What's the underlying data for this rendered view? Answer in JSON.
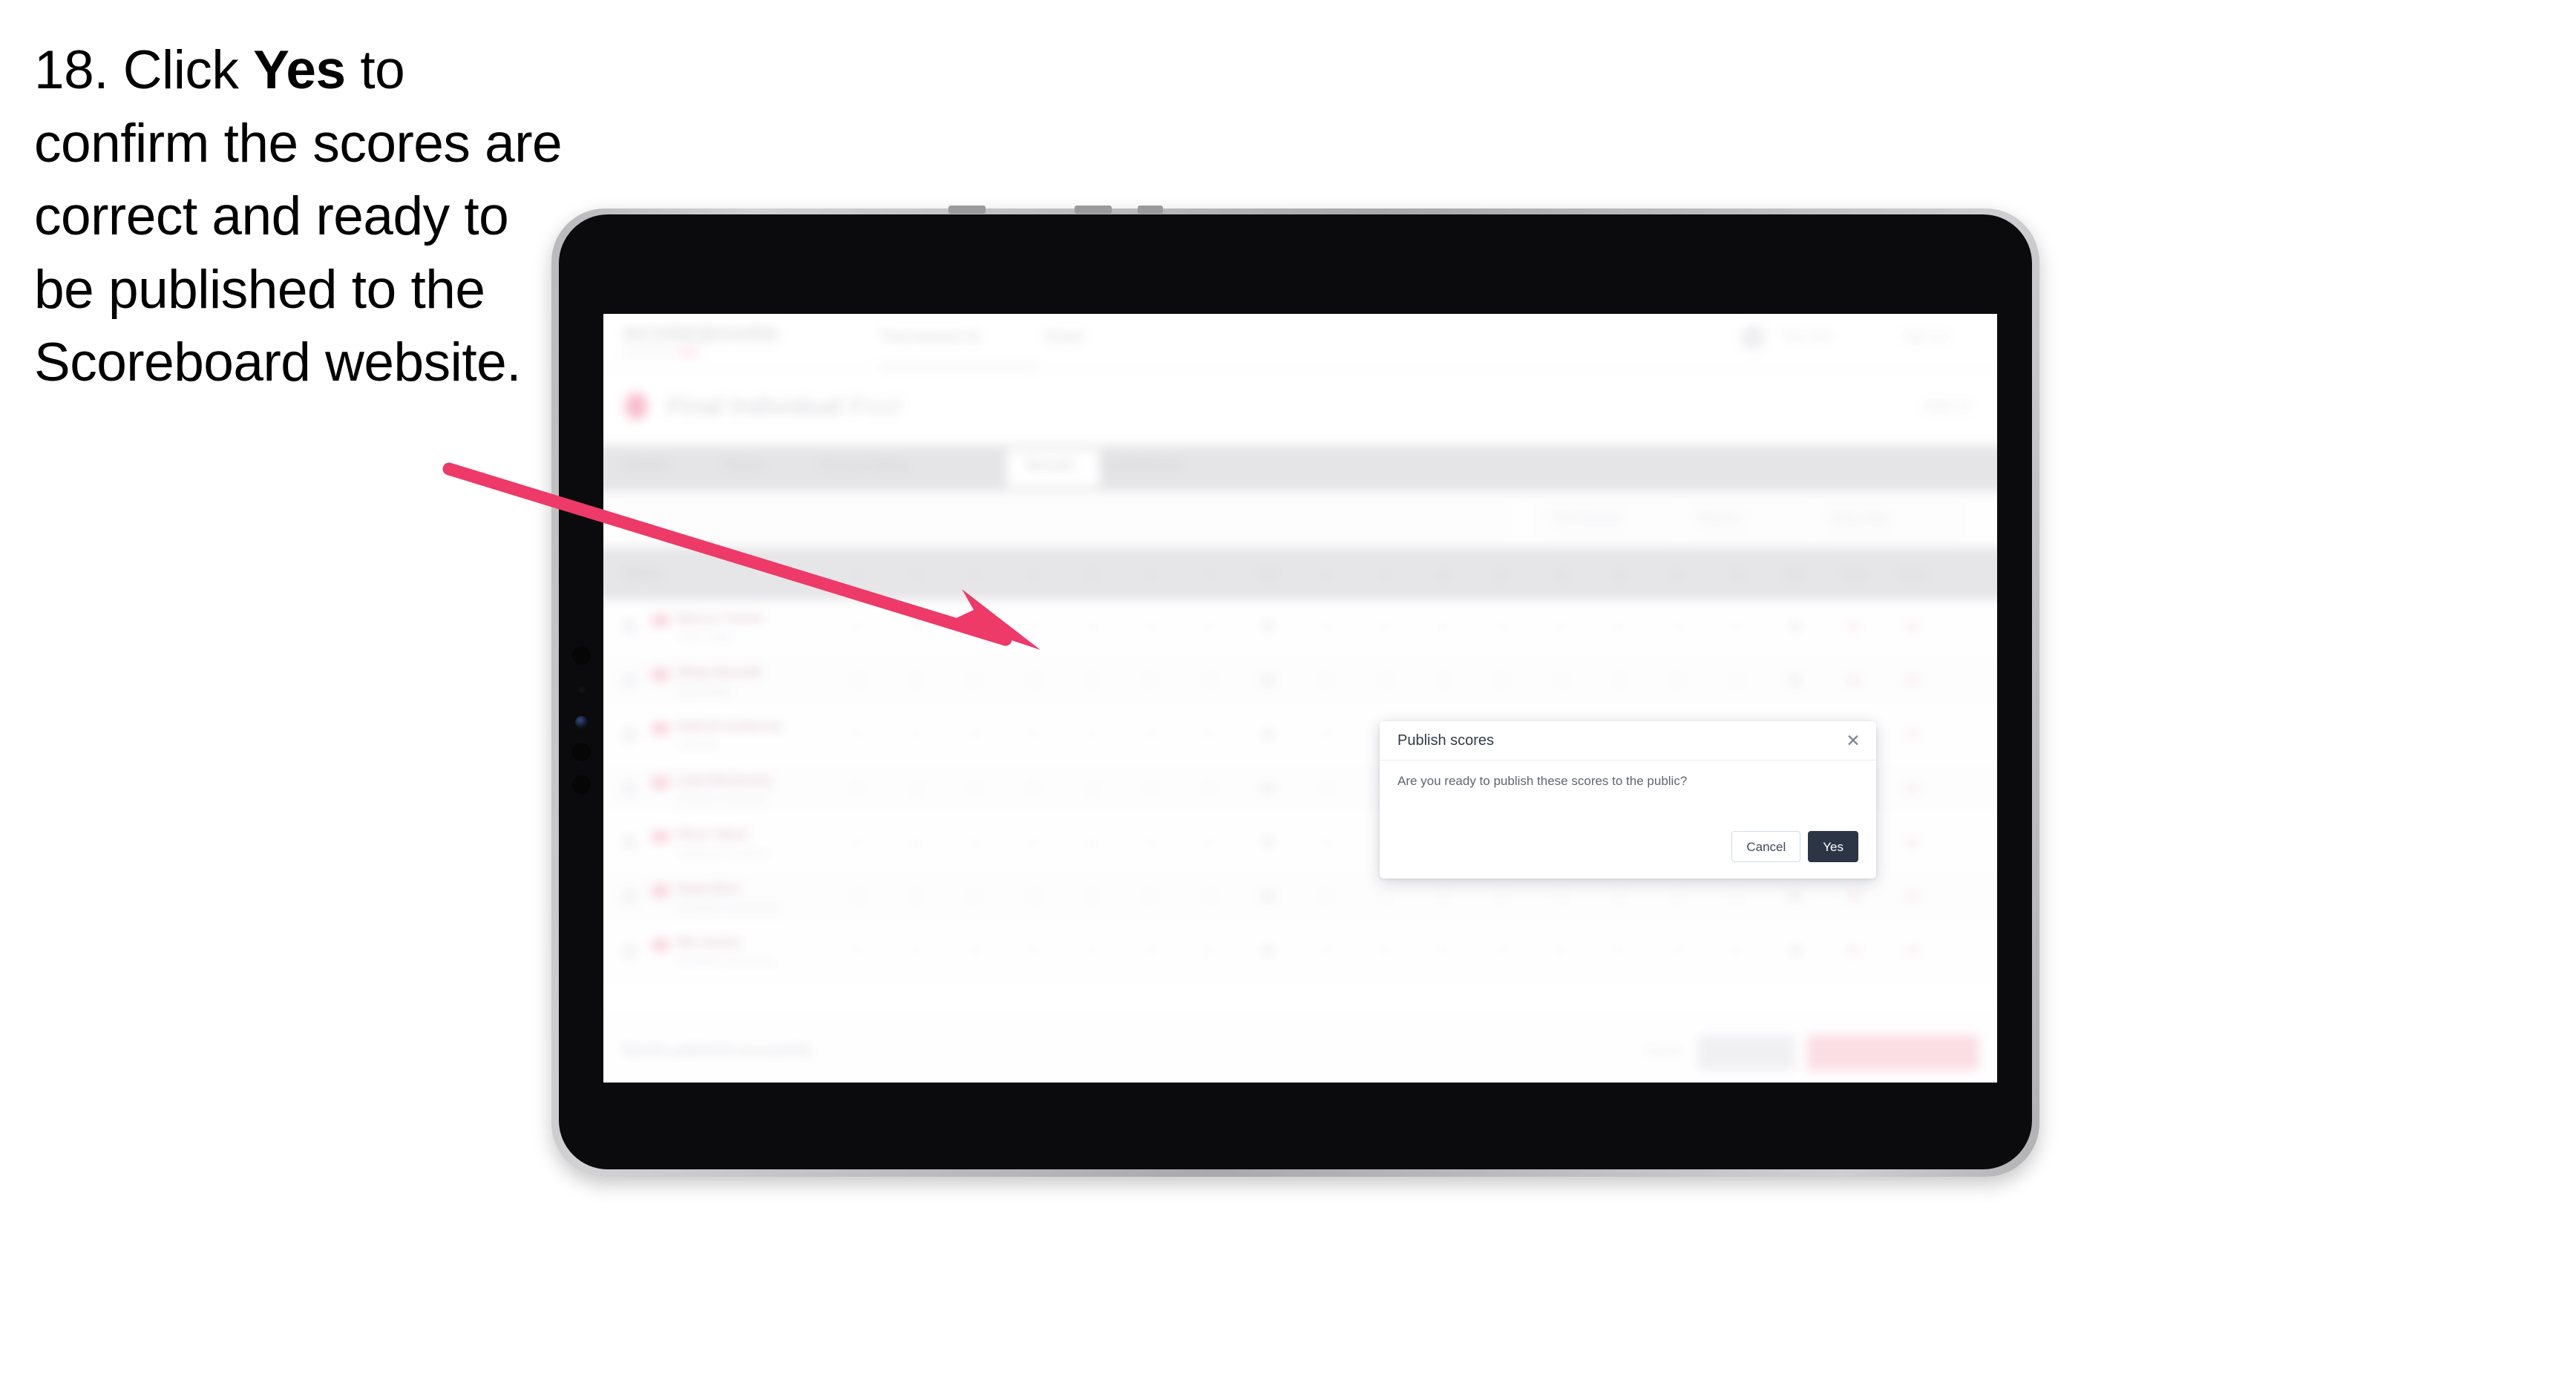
{
  "instruction": {
    "number": "18.",
    "lead": " Click ",
    "emphasis": "Yes",
    "rest": " to confirm the scores are correct and ready to be published to the Scoreboard website."
  },
  "annotation": {
    "arrow_color": "#ED3A68",
    "points_to": "yes-button"
  },
  "device": {
    "type": "tablet",
    "orientation": "landscape"
  },
  "dialog": {
    "title": "Publish scores",
    "message": "Are you ready to publish these scores to the public?",
    "close_icon": "close-icon",
    "close_glyph": "✕",
    "buttons": {
      "cancel": "Cancel",
      "yes": "Yes"
    },
    "colors": {
      "yes_bg": "#2C3545",
      "yes_text": "#FFFFFF",
      "cancel_border": "#D3DCEA",
      "title_text": "#323A47",
      "message_text": "#5D6472"
    }
  },
  "app": {
    "brand": "SCOREBOARD",
    "brand_sub": "powered by ",
    "brand_sub_accent": "GNG",
    "nav": [
      {
        "label": "Tournament 01"
      },
      {
        "label": "Event"
      }
    ],
    "header_right": [
      {
        "label": "Test User"
      },
      {
        "label": "Sign out"
      }
    ],
    "page_title": "Final Individual",
    "page_title_sub": "Pool",
    "page_title_right": "Heat 12",
    "tabs": [
      {
        "label": "Details",
        "active": false
      },
      {
        "label": "Teams",
        "active": false
      },
      {
        "label": "Course Setup",
        "active": false
      },
      {
        "label": "Results",
        "active": true
      },
      {
        "label": "Leaderboard",
        "active": false
      }
    ],
    "search_placeholder": "Search",
    "filters": [
      {
        "label": "First Session"
      },
      {
        "label": "Round 1"
      },
      {
        "label": "Entry Only"
      }
    ],
    "table": {
      "columns": [
        "Player",
        "1",
        "2",
        "3",
        "4",
        "5",
        "6",
        "7",
        "Sub",
        "8",
        "9",
        "10",
        "11",
        "12",
        "13",
        "14",
        "15",
        "Sub",
        "Total",
        "Score"
      ],
      "rows": [
        {
          "name": "Marcus Turner",
          "club": "Coast Valley",
          "cells": [
            "0",
            "0",
            "0",
            "0",
            "0",
            "0",
            "0",
            "00",
            "0",
            "0",
            "0",
            "0",
            "0",
            "0",
            "0",
            "0",
            "00",
            "00",
            "00"
          ]
        },
        {
          "name": "Ethan Russell",
          "club": "North Ridge",
          "cells": [
            "0",
            "0",
            "0",
            "0",
            "0",
            "0",
            "0",
            "00",
            "0",
            "0",
            "0",
            "0",
            "0",
            "0",
            "0",
            "0",
            "00",
            "00",
            "00"
          ]
        },
        {
          "name": "Gabriel Anderson",
          "club": "Lakeside",
          "cells": [
            "0",
            "0",
            "0",
            "0",
            "0",
            "0",
            "0",
            "00",
            "0",
            "0",
            "0",
            "0",
            "0",
            "0",
            "0",
            "0",
            "00",
            "00",
            "00"
          ]
        },
        {
          "name": "Liam Mcinerney",
          "club": "Southern Township",
          "cells": [
            "0",
            "0",
            "0",
            "0",
            "0",
            "0",
            "0",
            "00",
            "0",
            "0",
            "0",
            "0",
            "0",
            "0",
            "0",
            "0",
            "00",
            "00",
            "00"
          ]
        },
        {
          "name": "Oliver Ward",
          "club": "Eastbrook Academy",
          "cells": [
            "0",
            "0",
            "0",
            "0",
            "0",
            "0",
            "0",
            "00",
            "0",
            "0",
            "0",
            "0",
            "0",
            "0",
            "0",
            "0",
            "00",
            "00",
            "00"
          ]
        },
        {
          "name": "Noah Brier",
          "club": "Northgate Community",
          "cells": [
            "0",
            "0",
            "0",
            "0",
            "0",
            "0",
            "0",
            "00",
            "0",
            "0",
            "0",
            "0",
            "0",
            "0",
            "0",
            "0",
            "00",
            "00",
            "00"
          ]
        },
        {
          "name": "Mia Sutton",
          "club": "Westfield Community",
          "cells": [
            "0",
            "0",
            "0",
            "0",
            "0",
            "0",
            "0",
            "00",
            "0",
            "0",
            "0",
            "0",
            "0",
            "0",
            "0",
            "0",
            "00",
            "00",
            "00"
          ]
        }
      ]
    },
    "footer": {
      "note": "Results published successfully",
      "link": "Cancel",
      "grey_button": "Save All",
      "pink_button": "Unpublish from Scoreboard"
    }
  }
}
